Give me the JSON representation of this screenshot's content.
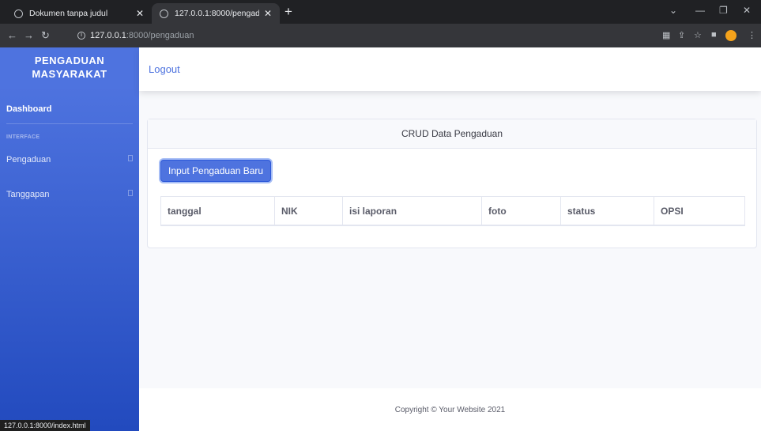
{
  "browser": {
    "tabs": [
      {
        "title": "Dokumen tanpa judul",
        "active": false
      },
      {
        "title": "127.0.0.1:8000/pengaduan",
        "active": true
      }
    ],
    "url_host": "127.0.0.1",
    "url_path": ":8000/pengaduan",
    "status_url": "127.0.0.1:8000/index.html"
  },
  "sidebar": {
    "brand_line1": "PENGADUAN",
    "brand_line2": "MASYARAKAT",
    "dashboard": "Dashboard",
    "heading": "INTERFACE",
    "items": [
      {
        "label": "Pengaduan"
      },
      {
        "label": "Tanggapan"
      }
    ]
  },
  "topbar": {
    "logout": "Logout"
  },
  "card": {
    "title": "CRUD Data Pengaduan",
    "button": "Input Pengaduan Baru",
    "columns": [
      "tanggal",
      "NIK",
      "isi laporan",
      "foto",
      "status",
      "OPSI"
    ]
  },
  "footer": {
    "copyright": "Copyright © Your Website 2021"
  },
  "colors": {
    "primary": "#4e73df",
    "sidebar_bottom": "#224abe"
  }
}
